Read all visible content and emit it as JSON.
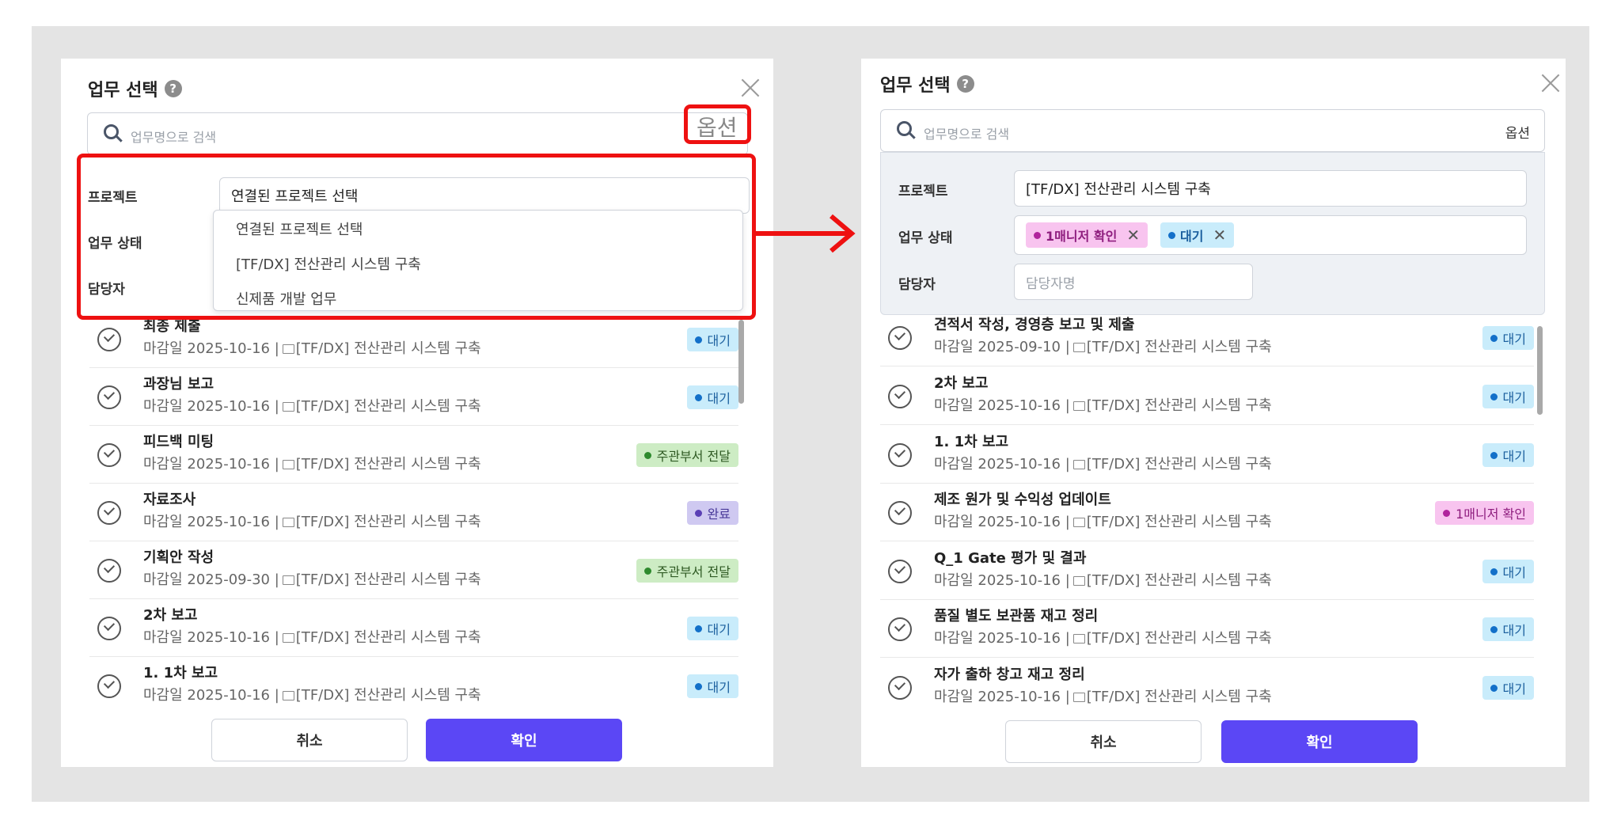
{
  "colors": {
    "accent": "#5b47f5",
    "highlight": "#ee1111",
    "status_wait_bg": "#c9ecfb",
    "status_wait_dot": "#1370c9",
    "status_wait_text": "#1b5f9e",
    "status_forward_bg": "#cdecc4",
    "status_forward_dot": "#2e8a2e",
    "status_forward_text": "#2f5a23",
    "status_done_bg": "#cfc9f1",
    "status_done_dot": "#5a3fb5",
    "status_done_text": "#4a3a9a",
    "status_manager_bg": "#f8c4ef",
    "status_manager_dot": "#b0249c",
    "status_manager_text": "#8e1d7e"
  },
  "left": {
    "title": "업무 선택",
    "help_icon": "?",
    "search_placeholder": "업무명으로 검색",
    "option_label": "옵션",
    "filters": {
      "project_label": "프로젝트",
      "status_label": "업무 상태",
      "assignee_label": "담당자",
      "project_value": "연결된 프로젝트 선택"
    },
    "dropdown": [
      "연결된 프로젝트 선택",
      "[TF/DX] 전산관리 시스템 구축",
      "신제품 개발 업무"
    ],
    "items": [
      {
        "title": "최종 제출",
        "sub": "마감일 2025-10-16 |",
        "project": "[TF/DX] 전산관리 시스템 구축",
        "status": "대기",
        "kind": "wait"
      },
      {
        "title": "과장님 보고",
        "sub": "마감일 2025-10-16 |",
        "project": "[TF/DX] 전산관리 시스템 구축",
        "status": "대기",
        "kind": "wait"
      },
      {
        "title": "피드백 미팅",
        "sub": "마감일 2025-10-16 |",
        "project": "[TF/DX] 전산관리 시스템 구축",
        "status": "주관부서 전달",
        "kind": "forward"
      },
      {
        "title": "자료조사",
        "sub": "마감일 2025-10-16 |",
        "project": "[TF/DX] 전산관리 시스템 구축",
        "status": "완료",
        "kind": "done"
      },
      {
        "title": "기획안 작성",
        "sub": "마감일 2025-09-30 |",
        "project": "[TF/DX] 전산관리 시스템 구축",
        "status": "주관부서 전달",
        "kind": "forward"
      },
      {
        "title": "2차 보고",
        "sub": "마감일 2025-10-16 |",
        "project": "[TF/DX] 전산관리 시스템 구축",
        "status": "대기",
        "kind": "wait"
      },
      {
        "title": "1. 1차 보고",
        "sub": "마감일 2025-10-16 |",
        "project": "[TF/DX] 전산관리 시스템 구축",
        "status": "대기",
        "kind": "wait"
      }
    ],
    "cancel": "취소",
    "confirm": "확인"
  },
  "right": {
    "title": "업무 선택",
    "help_icon": "?",
    "search_placeholder": "업무명으로 검색",
    "option_label": "옵션",
    "filters": {
      "project_label": "프로젝트",
      "status_label": "업무 상태",
      "assignee_label": "담당자",
      "project_value": "[TF/DX] 전산관리 시스템 구축",
      "assignee_placeholder": "담당자명",
      "status_tags": [
        {
          "label": "1매니저 확인",
          "kind": "manager"
        },
        {
          "label": "대기",
          "kind": "wait"
        }
      ]
    },
    "items": [
      {
        "title": "견적서 작성, 경영층 보고 및 제출",
        "sub": "마감일 2025-09-10 |",
        "project": "[TF/DX] 전산관리 시스템 구축",
        "status": "대기",
        "kind": "wait"
      },
      {
        "title": "2차 보고",
        "sub": "마감일 2025-10-16 |",
        "project": "[TF/DX] 전산관리 시스템 구축",
        "status": "대기",
        "kind": "wait"
      },
      {
        "title": "1. 1차 보고",
        "sub": "마감일 2025-10-16 |",
        "project": "[TF/DX] 전산관리 시스템 구축",
        "status": "대기",
        "kind": "wait"
      },
      {
        "title": "제조 원가 및 수익성 업데이트",
        "sub": "마감일 2025-10-16 |",
        "project": "[TF/DX] 전산관리 시스템 구축",
        "status": "1매니저 확인",
        "kind": "manager"
      },
      {
        "title": "Q_1 Gate 평가 및 결과",
        "sub": "마감일 2025-10-16 |",
        "project": "[TF/DX] 전산관리 시스템 구축",
        "status": "대기",
        "kind": "wait"
      },
      {
        "title": "품질 별도 보관품 재고 정리",
        "sub": "마감일 2025-10-16 |",
        "project": "[TF/DX] 전산관리 시스템 구축",
        "status": "대기",
        "kind": "wait"
      },
      {
        "title": "자가 출하 창고 재고 정리",
        "sub": "마감일 2025-10-16 |",
        "project": "[TF/DX] 전산관리 시스템 구축",
        "status": "대기",
        "kind": "wait"
      }
    ],
    "cancel": "취소",
    "confirm": "확인"
  }
}
